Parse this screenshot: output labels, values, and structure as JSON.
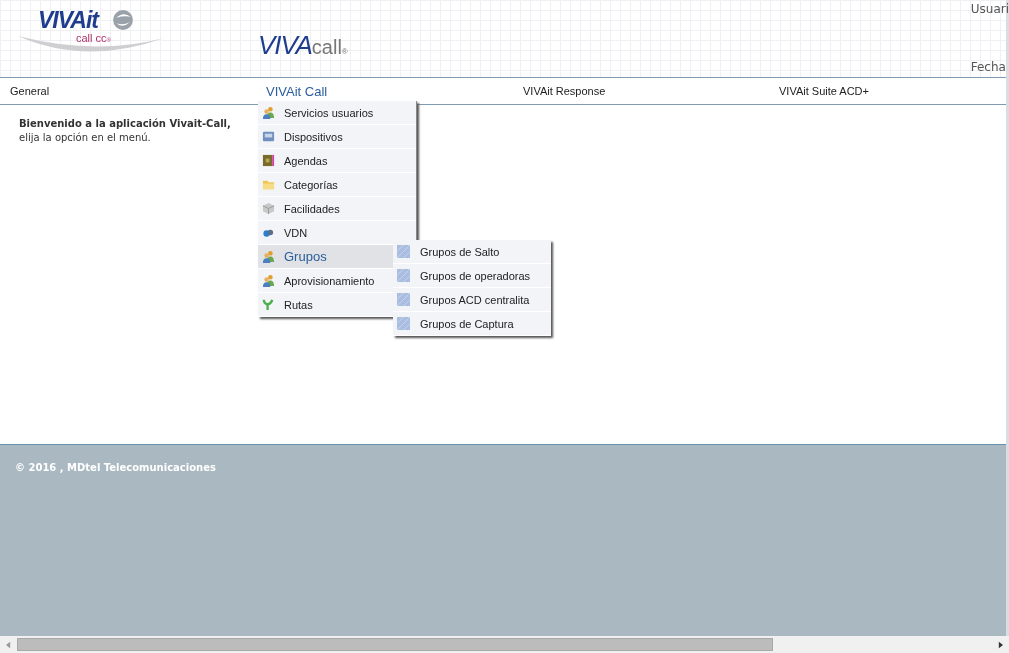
{
  "header": {
    "logo": {
      "brand": "VIVAit",
      "sub": "call cc",
      "mark": "®"
    },
    "app_logo": {
      "bold": "VIVA",
      "light": "call",
      "mark": "®"
    },
    "user_label": "Usuari",
    "date_label": "Fecha"
  },
  "nav": [
    {
      "label": "General",
      "selected": false
    },
    {
      "label": "VIVAit Call",
      "selected": true
    },
    {
      "label": "VIVAit Response",
      "selected": false
    },
    {
      "label": "VIVAit Suite ACD+",
      "selected": false
    }
  ],
  "menu": [
    {
      "label": "Servicios usuarios",
      "kind": "users",
      "selected": false
    },
    {
      "label": "Dispositivos",
      "kind": "device",
      "selected": false
    },
    {
      "label": "Agendas",
      "kind": "book",
      "selected": false
    },
    {
      "label": "Categorías",
      "kind": "folder",
      "selected": false
    },
    {
      "label": "Facilidades",
      "kind": "cube",
      "selected": false
    },
    {
      "label": "VDN",
      "kind": "cloud",
      "selected": false
    },
    {
      "label": "Grupos",
      "kind": "users",
      "selected": true
    },
    {
      "label": "Aprovisionamiento",
      "kind": "users",
      "selected": false
    },
    {
      "label": "Rutas",
      "kind": "plant",
      "selected": false
    }
  ],
  "submenu": [
    {
      "label": "Grupos de Salto"
    },
    {
      "label": "Grupos de operadoras"
    },
    {
      "label": "Grupos ACD centralita"
    },
    {
      "label": "Grupos de Captura"
    }
  ],
  "welcome": {
    "title": "Bienvenido a la aplicación Vivait-Call,",
    "text": "elija la opción en el menú."
  },
  "footer": "© 2016 , MDtel Telecomunicaciones"
}
